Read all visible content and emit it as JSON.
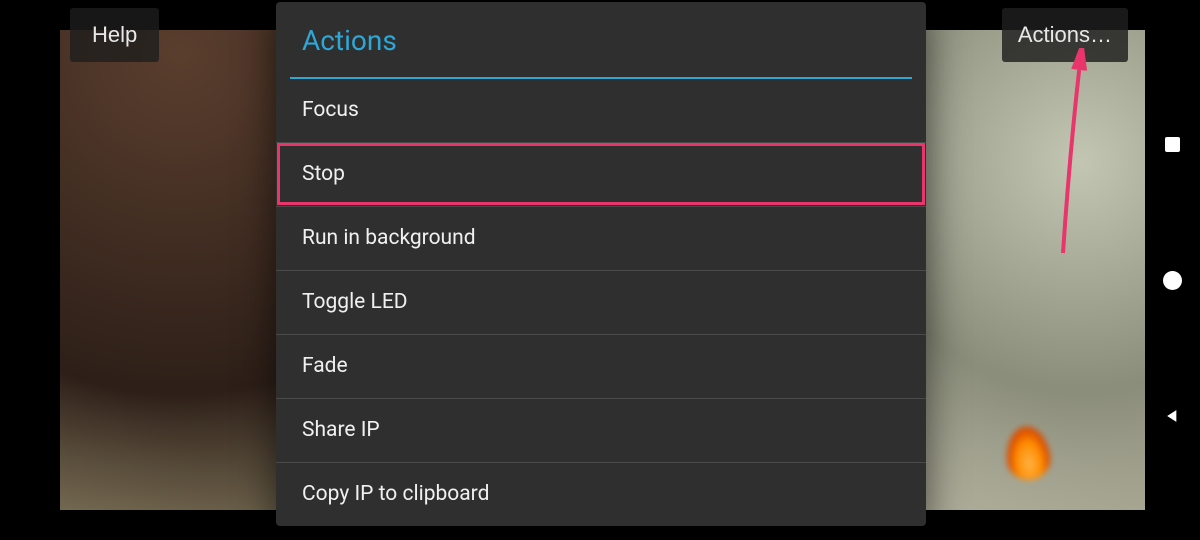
{
  "help_button": {
    "label": "Help"
  },
  "actions_button": {
    "label": "Actions…"
  },
  "modal": {
    "title": "Actions",
    "items": [
      {
        "label": "Focus",
        "highlighted": false
      },
      {
        "label": "Stop",
        "highlighted": true
      },
      {
        "label": "Run in background",
        "highlighted": false
      },
      {
        "label": "Toggle LED",
        "highlighted": false
      },
      {
        "label": "Fade",
        "highlighted": false
      },
      {
        "label": "Share IP",
        "highlighted": false
      },
      {
        "label": "Copy IP to clipboard",
        "highlighted": false
      }
    ]
  },
  "annotation": {
    "arrow_color": "#e8356b"
  },
  "nav": {
    "recent": "recent-apps",
    "home": "home",
    "back": "back"
  }
}
